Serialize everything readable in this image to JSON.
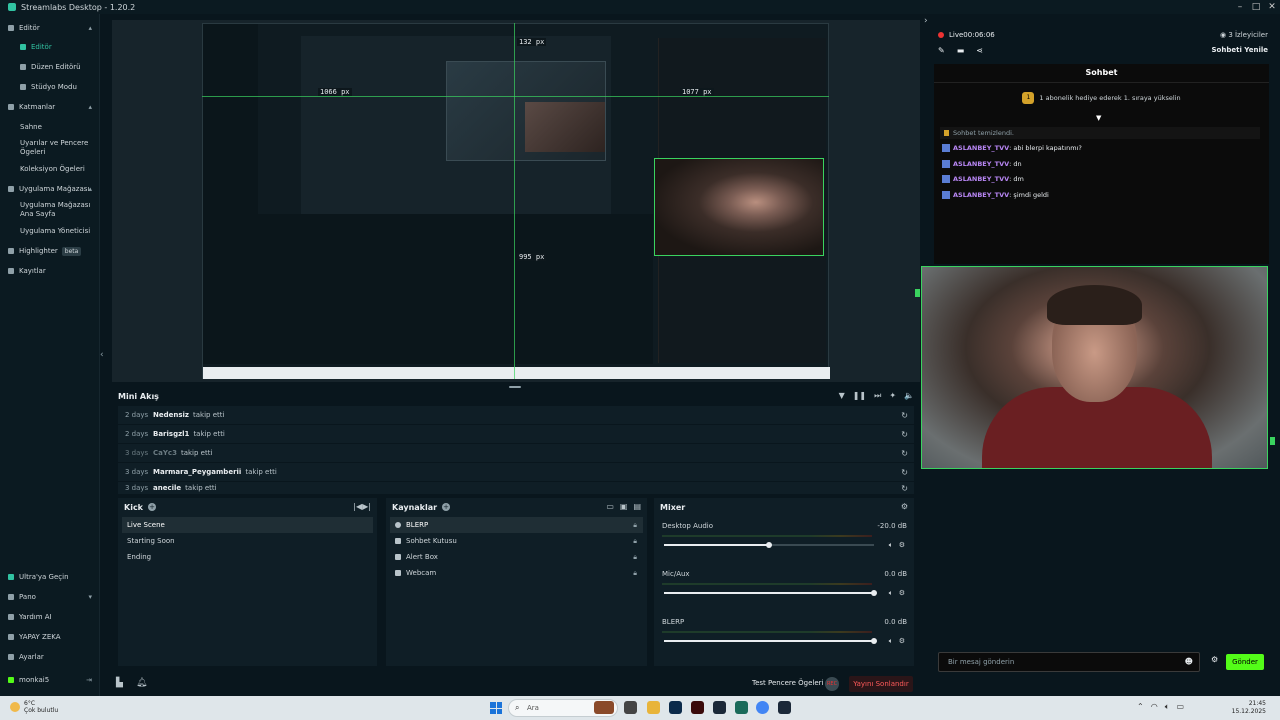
{
  "titlebar": {
    "title": "Streamlabs Desktop - 1.20.2"
  },
  "sidebar": {
    "editor_group": "Editör",
    "editor": "Editör",
    "layout_editor": "Düzen Editörü",
    "studio_mode": "Stüdyo Modu",
    "layers_group": "Katmanlar",
    "scene": "Sahne",
    "widgets": "Uyarılar ve Pencere Ögeleri",
    "collections": "Koleksiyon Ögeleri",
    "appstore_group": "Uygulama Mağazası",
    "appstore_home": "Uygulama Mağazası Ana Sayfa",
    "app_manager": "Uygulama Yöneticisi",
    "highlighter": "Highlighter",
    "highlighter_badge": "beta",
    "recordings": "Kayıtlar",
    "ultra": "Ultra'ya Geçin",
    "dashboard": "Pano",
    "help_ai": "Yardım AI",
    "ai": "YAPAY ZEKA",
    "settings": "Ayarlar",
    "account": "monkai5"
  },
  "preview": {
    "measure_top": "132 px",
    "measure_left": "1066 px",
    "measure_right": "1077 px",
    "measure_bottom": "995 px"
  },
  "mini_feed": {
    "title": "Mini Akış",
    "rows": [
      {
        "age": "2 days",
        "name": "Nedensiz",
        "action": "takip etti"
      },
      {
        "age": "2 days",
        "name": "Barisgzl1",
        "action": "takip etti"
      },
      {
        "age": "3 days",
        "name": "CaYc3",
        "action": "takip etti"
      },
      {
        "age": "3 days",
        "name": "Marmara_Peygamberii",
        "action": "takip etti"
      },
      {
        "age": "3 days",
        "name": "anecile",
        "action": "takip etti"
      }
    ]
  },
  "scenes": {
    "title": "Kick",
    "items": [
      "Live Scene",
      "Starting Soon",
      "Ending"
    ]
  },
  "sources": {
    "title": "Kaynaklar",
    "items": [
      "BLERP",
      "Sohbet Kutusu",
      "Alert Box",
      "Webcam"
    ]
  },
  "mixer": {
    "title": "Mixer",
    "channels": [
      {
        "name": "Desktop Audio",
        "db": "-20.0 dB",
        "level": 0.5
      },
      {
        "name": "Mic/Aux",
        "db": "0.0 dB",
        "level": 1.0
      },
      {
        "name": "BLERP",
        "db": "0.0 dB",
        "level": 1.0
      }
    ]
  },
  "footer": {
    "test_widgets": "Test Pencere Ögeleri",
    "rec_label": "REC",
    "end_stream": "Yayını Sonlandır"
  },
  "chat": {
    "live_label": "Live",
    "live_time": "00:06:06",
    "viewers": "3 İzleyiciler",
    "refresh": "Sohbeti Yenile",
    "header": "Sohbet",
    "promo": "1 abonelik hediye ederek 1. sıraya yükselin",
    "promo_rank": "1",
    "cleared": "Sohbet temizlendi.",
    "messages": [
      {
        "user": "ASLANBEY_TVV",
        "text": ": abi blerpi kapatınmı?"
      },
      {
        "user": "ASLANBEY_TVV",
        "text": ": dn"
      },
      {
        "user": "ASLANBEY_TVV",
        "text": ": dm"
      },
      {
        "user": "ASLANBEY_TVV",
        "text": ": şimdi geldi"
      }
    ],
    "input_placeholder": "Bir mesaj gönderin",
    "send": "Gönder"
  },
  "taskbar": {
    "temp": "6°C",
    "weather": "Çok bulutlu",
    "search": "Ara",
    "time": "21:45",
    "date": "15.12.2025"
  },
  "colors": {
    "accent": "#31c3a2",
    "kick_green": "#53fc18",
    "end_red": "#ff5a5a",
    "chat_user": "#b987f5"
  }
}
